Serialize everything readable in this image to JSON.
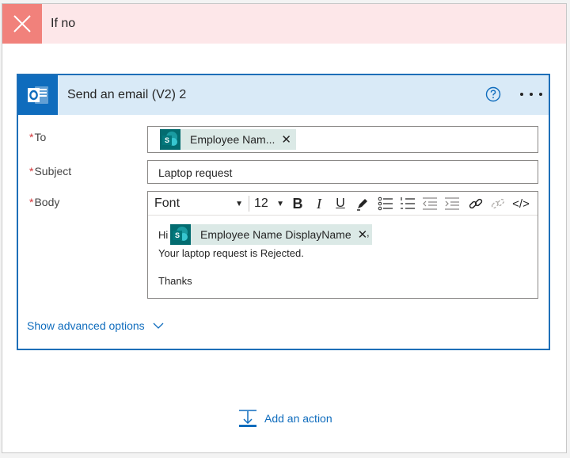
{
  "branch": {
    "title": "If no",
    "color": "#f1817b"
  },
  "card": {
    "title": "Send an email (V2) 2",
    "accent": "#0f6cbd",
    "fields": {
      "to": {
        "label": "To",
        "token": "Employee Nam...",
        "required": "*"
      },
      "subject": {
        "label": "Subject",
        "value": "Laptop request",
        "required": "*"
      },
      "body": {
        "label": "Body",
        "required": "*",
        "toolbar": {
          "font": "Font",
          "size": "12"
        },
        "greeting": "Hi",
        "token": "Employee Name DisplayName",
        "after_token": ",",
        "line2": "Your laptop request is Rejected.",
        "line3": "Thanks"
      }
    },
    "advanced_label": "Show advanced options"
  },
  "add_action": {
    "label": "Add an action"
  }
}
